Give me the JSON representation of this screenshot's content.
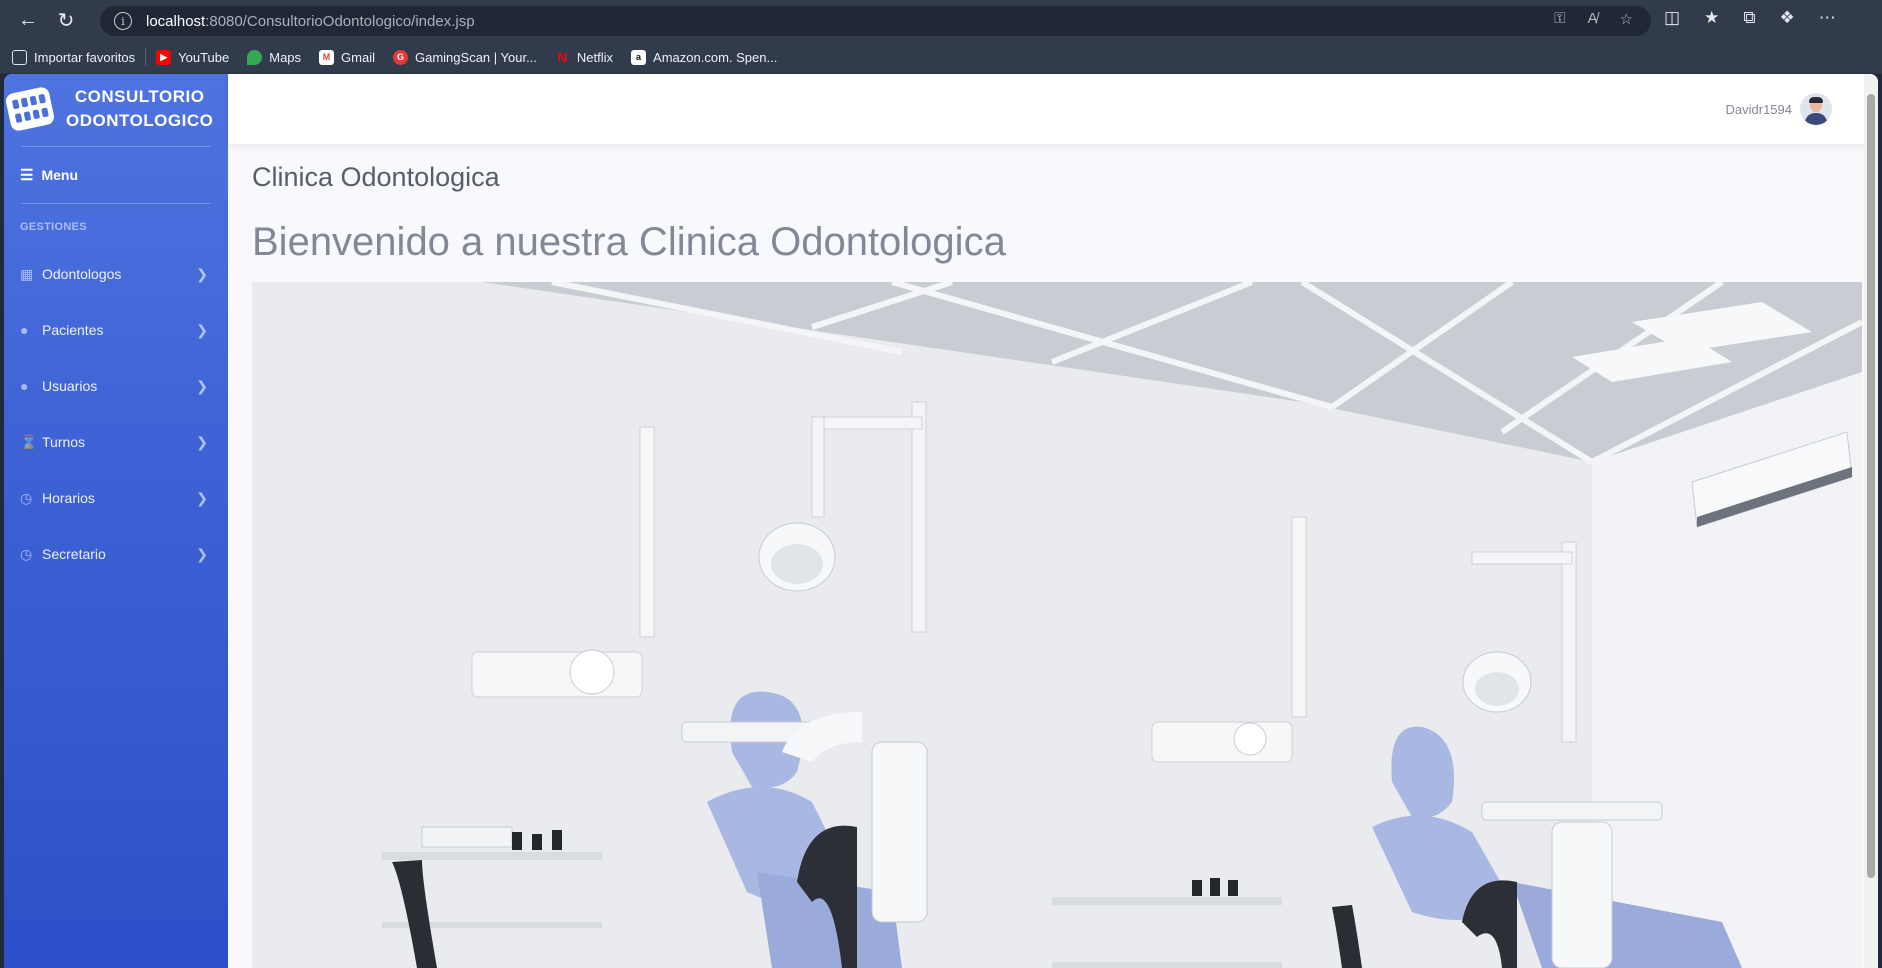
{
  "browser": {
    "url_host": "localhost",
    "url_path": ":8080/ConsultorioOdontologico/index.jsp",
    "bookmarks": [
      {
        "label": "Importar favoritos",
        "icon": "import-icon",
        "color": "#313b4c"
      },
      {
        "label": "YouTube",
        "icon": "youtube-icon",
        "color": "#ff0000"
      },
      {
        "label": "Maps",
        "icon": "maps-icon",
        "color": "#34a853"
      },
      {
        "label": "Gmail",
        "icon": "gmail-icon",
        "color": "#ea4335"
      },
      {
        "label": "GamingScan | Your...",
        "icon": "gamingscan-icon",
        "color": "#e53935"
      },
      {
        "label": "Netflix",
        "icon": "netflix-icon",
        "color": "#e50914"
      },
      {
        "label": "Amazon.com. Spen...",
        "icon": "amazon-icon",
        "color": "#ffffff"
      }
    ]
  },
  "sidebar": {
    "brand_line1": "CONSULTORIO",
    "brand_line2": "ODONTOLOGICO",
    "menu_label": "Menu",
    "section_heading": "GESTIONES",
    "items": [
      {
        "label": "Odontologos",
        "icon": "clinic-users-icon"
      },
      {
        "label": "Pacientes",
        "icon": "user-icon"
      },
      {
        "label": "Usuarios",
        "icon": "user-icon"
      },
      {
        "label": "Turnos",
        "icon": "hourglass-icon"
      },
      {
        "label": "Horarios",
        "icon": "clock-icon"
      },
      {
        "label": "Secretario",
        "icon": "clock-icon"
      }
    ]
  },
  "topbar": {
    "username": "Davidr1594"
  },
  "main": {
    "title": "Clinica Odontologica",
    "welcome": "Bienvenido a nuestra Clinica Odontologica"
  },
  "colors": {
    "sidebar_top": "#4f74e0",
    "sidebar_bottom": "#2d4fc9",
    "chair_blue": "#a9b7e3"
  }
}
